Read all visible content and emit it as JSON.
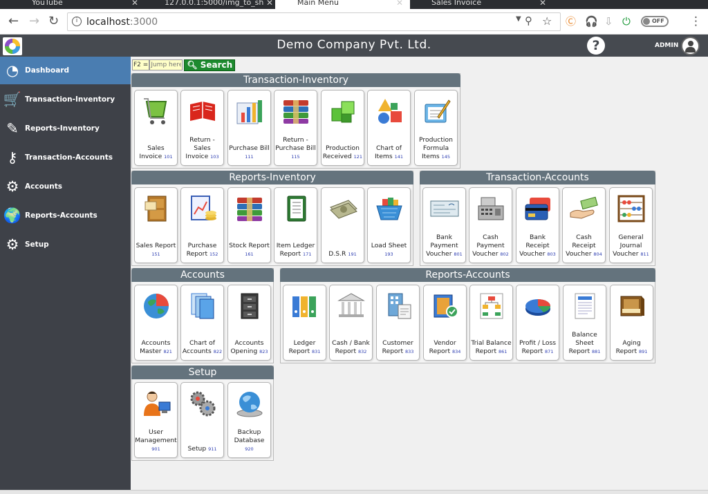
{
  "browser": {
    "tabs": [
      {
        "label": "YouTube",
        "active": false
      },
      {
        "label": "127.0.0.1:5000/img_to_sh",
        "active": false
      },
      {
        "label": "Main Menu",
        "active": true
      },
      {
        "label": "Sales Invoice",
        "active": false
      }
    ],
    "address": {
      "host": "localhost",
      "port": ":3000"
    },
    "toggle_label": "OFF"
  },
  "header": {
    "company": "Demo Company Pvt. Ltd.",
    "help": "?",
    "user": "ADMIN"
  },
  "sidebar": {
    "items": [
      {
        "label": "Dashboard",
        "icon": "dashboard-icon"
      },
      {
        "label": "Transaction-Inventory",
        "icon": "shopping-cart-icon"
      },
      {
        "label": "Reports-Inventory",
        "icon": "edit-pencil-icon"
      },
      {
        "label": "Transaction-Accounts",
        "icon": "key-icon"
      },
      {
        "label": "Accounts",
        "icon": "gear-icon"
      },
      {
        "label": "Reports-Accounts",
        "icon": "globe-icon"
      },
      {
        "label": "Setup",
        "icon": "gears-icon"
      }
    ]
  },
  "search": {
    "hint": "F2 =",
    "placeholder": "Jump here",
    "button": "Search"
  },
  "panels": [
    {
      "title": "Transaction-Inventory",
      "tiles": [
        {
          "name": "Sales Invoice",
          "code": "101",
          "icon": "shopping-cart-icon"
        },
        {
          "name": "Return - Sales Invoice",
          "code": "103",
          "icon": "book-return-icon"
        },
        {
          "name": "Purchase Bill",
          "code": "111",
          "icon": "bar-chart-icon"
        },
        {
          "name": "Return - Purchase Bill",
          "code": "115",
          "icon": "books-icon"
        },
        {
          "name": "Production Received",
          "code": "121",
          "icon": "green-cubes-icon"
        },
        {
          "name": "Chart of Items",
          "code": "141",
          "icon": "shapes-icon"
        },
        {
          "name": "Production Formula Items",
          "code": "145",
          "icon": "notepad-pencil-icon"
        }
      ]
    },
    {
      "title": "Reports-Inventory",
      "tiles": [
        {
          "name": "Sales Report",
          "code": "151",
          "icon": "file-cabinet-icon"
        },
        {
          "name": "Purchase Report",
          "code": "152",
          "icon": "report-coins-icon"
        },
        {
          "name": "Stock Report",
          "code": "161",
          "icon": "books-icon"
        },
        {
          "name": "Item Ledger Report",
          "code": "171",
          "icon": "ledger-book-icon"
        },
        {
          "name": "D.S.R",
          "code": "191",
          "icon": "money-stack-icon"
        },
        {
          "name": "Load Sheet",
          "code": "193",
          "icon": "basket-icon"
        }
      ]
    },
    {
      "title": "Transaction-Accounts",
      "tiles": [
        {
          "name": "Bank Payment Voucher",
          "code": "801",
          "icon": "cheque-icon"
        },
        {
          "name": "Cash Payment Voucher",
          "code": "802",
          "icon": "cash-register-icon"
        },
        {
          "name": "Bank Receipt Voucher",
          "code": "803",
          "icon": "credit-cards-icon"
        },
        {
          "name": "Cash Receipt Voucher",
          "code": "804",
          "icon": "hand-cash-icon"
        },
        {
          "name": "General Journal Voucher",
          "code": "811",
          "icon": "abacus-icon"
        }
      ]
    },
    {
      "title": "Accounts",
      "tiles": [
        {
          "name": "Accounts Master",
          "code": "821",
          "icon": "pie-globe-icon"
        },
        {
          "name": "Chart of Accounts",
          "code": "822",
          "icon": "documents-icon"
        },
        {
          "name": "Accounts Opening",
          "code": "823",
          "icon": "cabinet-icon"
        }
      ]
    },
    {
      "title": "Reports-Accounts",
      "tiles": [
        {
          "name": "Ledger Report",
          "code": "831",
          "icon": "binders-icon"
        },
        {
          "name": "Cash / Bank Report",
          "code": "832",
          "icon": "bank-icon"
        },
        {
          "name": "Customer Report",
          "code": "833",
          "icon": "building-report-icon"
        },
        {
          "name": "Vendor Report",
          "code": "834",
          "icon": "address-book-icon"
        },
        {
          "name": "Trial Balance Report",
          "code": "861",
          "icon": "org-chart-icon"
        },
        {
          "name": "Profit / Loss Report",
          "code": "871",
          "icon": "pie-chart-icon"
        },
        {
          "name": "Balance Sheet Report",
          "code": "881",
          "icon": "sheet-icon"
        },
        {
          "name": "Aging Report",
          "code": "891",
          "icon": "old-box-icon"
        }
      ]
    },
    {
      "title": "Setup",
      "tiles": [
        {
          "name": "User Management",
          "code": "901",
          "icon": "user-computer-icon"
        },
        {
          "name": "Setup",
          "code": "911",
          "icon": "gears-icon"
        },
        {
          "name": "Backup Database",
          "code": "920",
          "icon": "globe-disk-icon"
        }
      ]
    }
  ]
}
